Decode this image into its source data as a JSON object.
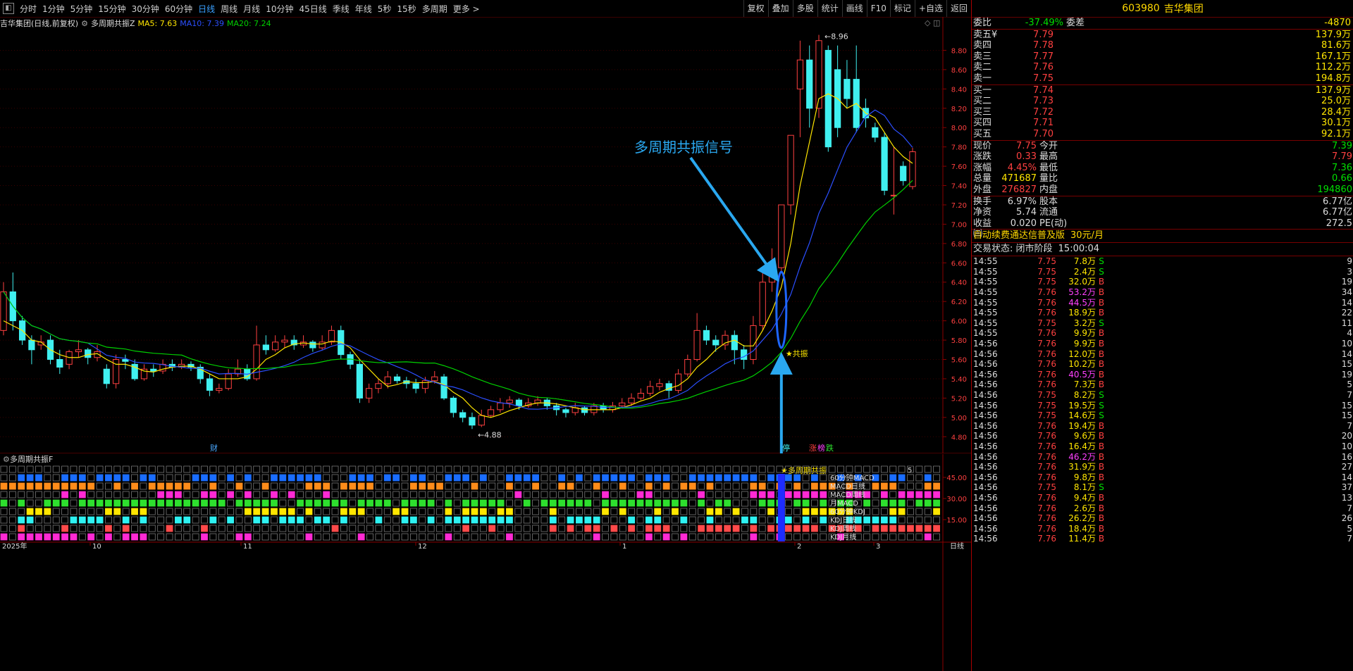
{
  "toolbar": {
    "timeframes": [
      "分时",
      "1分钟",
      "5分钟",
      "15分钟",
      "30分钟",
      "60分钟",
      "日线",
      "周线",
      "月线",
      "10分钟",
      "45日线",
      "季线",
      "年线",
      "5秒",
      "15秒",
      "多周期",
      "更多 >"
    ],
    "active_timeframe": "日线",
    "tools": [
      "复权",
      "叠加",
      "多股",
      "统计",
      "画线",
      "F10",
      "标记",
      "+自选",
      "返回"
    ]
  },
  "chart_info": {
    "title": "吉华集团(日线,前复权)",
    "indicator": "多周期共振Z",
    "ma5": "MA5: 7.63",
    "ma10": "MA10: 7.39",
    "ma20": "MA20: 7.24"
  },
  "annotation": {
    "label": "多周期共振信号",
    "signal_text": "★共振",
    "high_label": "8.96",
    "low_label": "←4.88",
    "finance_mark": "财",
    "limit_marks": [
      "停",
      "涨",
      "榜",
      "跌"
    ]
  },
  "price_axis": [
    "8.80",
    "8.60",
    "8.40",
    "8.20",
    "8.00",
    "7.80",
    "7.60",
    "7.40",
    "7.20",
    "7.00",
    "6.80",
    "6.60",
    "6.40",
    "6.20",
    "6.00",
    "5.80",
    "5.60",
    "5.40",
    "5.20",
    "5.00",
    "4.80"
  ],
  "sub_axis": [
    "45.00",
    "30.00",
    "15.00"
  ],
  "date_axis": [
    "2025年",
    "10",
    "11",
    "12",
    "1",
    "2",
    "3",
    "日线"
  ],
  "sub_panel": {
    "title": "多周期共振F",
    "signal_label": "★多周期共振",
    "row_labels": [
      "60分钟MACD",
      "MACD日线",
      "MACD周线",
      "月MACD",
      "60分钟KDJ",
      "KDJ日线",
      "KDJ周线",
      "KDJ月线"
    ],
    "row_colors": [
      "#1a6dff",
      "#ff8c1a",
      "#ff2ad4",
      "#2ee02e",
      "#ffe600",
      "#2ef2f2",
      "#ff4a4a",
      "#ff2ad4"
    ],
    "corner": "5"
  },
  "chart_data": {
    "type": "candlestick",
    "title": "吉华集团(日线,前复权)",
    "ylim": [
      4.7,
      9.0
    ],
    "high": 8.96,
    "low": 4.88,
    "candles": [
      [
        5.9,
        6.3,
        6.4,
        5.85
      ],
      [
        6.3,
        6.0,
        6.5,
        5.9
      ],
      [
        6.0,
        5.8,
        6.05,
        5.75
      ],
      [
        5.8,
        5.7,
        5.85,
        5.55
      ],
      [
        5.75,
        5.78,
        5.85,
        5.7
      ],
      [
        5.8,
        5.6,
        5.85,
        5.55
      ],
      [
        5.6,
        5.52,
        5.7,
        5.45
      ],
      [
        5.55,
        5.68,
        5.7,
        5.5
      ],
      [
        5.68,
        5.7,
        5.8,
        5.62
      ],
      [
        5.7,
        5.62,
        5.72,
        5.55
      ],
      [
        5.62,
        5.68,
        5.75,
        5.58
      ],
      [
        5.5,
        5.35,
        5.55,
        5.3
      ],
      [
        5.35,
        5.6,
        5.65,
        5.3
      ],
      [
        5.6,
        5.58,
        5.65,
        5.5
      ],
      [
        5.55,
        5.4,
        5.6,
        5.38
      ],
      [
        5.4,
        5.5,
        5.55,
        5.38
      ],
      [
        5.5,
        5.48,
        5.55,
        5.42
      ],
      [
        5.48,
        5.55,
        5.6,
        5.45
      ],
      [
        5.55,
        5.52,
        5.6,
        5.48
      ],
      [
        5.52,
        5.55,
        5.6,
        5.5
      ],
      [
        5.55,
        5.52,
        5.58,
        5.48
      ],
      [
        5.52,
        5.4,
        5.55,
        5.35
      ],
      [
        5.4,
        5.28,
        5.45,
        5.22
      ],
      [
        5.28,
        5.3,
        5.35,
        5.25
      ],
      [
        5.3,
        5.45,
        5.5,
        5.28
      ],
      [
        5.45,
        5.5,
        5.6,
        5.42
      ],
      [
        5.5,
        5.4,
        5.55,
        5.38
      ],
      [
        5.4,
        5.75,
        5.95,
        5.38
      ],
      [
        5.75,
        5.7,
        5.85,
        5.65
      ],
      [
        5.7,
        5.78,
        5.85,
        5.68
      ],
      [
        5.78,
        5.8,
        5.85,
        5.72
      ],
      [
        5.8,
        5.75,
        5.85,
        5.7
      ],
      [
        5.75,
        5.78,
        5.85,
        5.72
      ],
      [
        5.78,
        5.72,
        5.8,
        5.68
      ],
      [
        5.72,
        5.78,
        5.85,
        5.7
      ],
      [
        5.78,
        5.9,
        5.95,
        5.75
      ],
      [
        5.9,
        5.65,
        5.95,
        5.6
      ],
      [
        5.65,
        5.55,
        5.68,
        5.5
      ],
      [
        5.55,
        5.2,
        5.6,
        5.15
      ],
      [
        5.2,
        5.3,
        5.35,
        5.15
      ],
      [
        5.3,
        5.35,
        5.4,
        5.25
      ],
      [
        5.35,
        5.42,
        5.48,
        5.3
      ],
      [
        5.42,
        5.38,
        5.45,
        5.35
      ],
      [
        5.38,
        5.35,
        5.42,
        5.3
      ],
      [
        5.35,
        5.3,
        5.4,
        5.25
      ],
      [
        5.3,
        5.38,
        5.42,
        5.25
      ],
      [
        5.38,
        5.42,
        5.48,
        5.35
      ],
      [
        5.42,
        5.2,
        5.45,
        5.18
      ],
      [
        5.2,
        5.05,
        5.22,
        5.0
      ],
      [
        5.05,
        5.0,
        5.08,
        4.95
      ],
      [
        5.0,
        4.92,
        5.05,
        4.88
      ],
      [
        4.92,
        5.02,
        5.08,
        4.9
      ],
      [
        5.02,
        5.08,
        5.12,
        5.0
      ],
      [
        5.08,
        5.15,
        5.2,
        5.05
      ],
      [
        5.15,
        5.18,
        5.22,
        5.1
      ],
      [
        5.18,
        5.12,
        5.2,
        5.08
      ],
      [
        5.12,
        5.15,
        5.2,
        5.1
      ],
      [
        5.15,
        5.18,
        5.22,
        5.12
      ],
      [
        5.18,
        5.12,
        5.2,
        5.08
      ],
      [
        5.12,
        5.08,
        5.15,
        5.02
      ],
      [
        5.08,
        5.05,
        5.1,
        5.0
      ],
      [
        5.05,
        5.1,
        5.15,
        5.02
      ],
      [
        5.1,
        5.05,
        5.12,
        5.02
      ],
      [
        5.05,
        5.12,
        5.15,
        5.02
      ],
      [
        5.12,
        5.08,
        5.15,
        5.05
      ],
      [
        5.08,
        5.12,
        5.16,
        5.05
      ],
      [
        5.12,
        5.15,
        5.2,
        5.1
      ],
      [
        5.15,
        5.2,
        5.25,
        5.12
      ],
      [
        5.2,
        5.25,
        5.3,
        5.18
      ],
      [
        5.25,
        5.32,
        5.38,
        5.22
      ],
      [
        5.32,
        5.35,
        5.4,
        5.28
      ],
      [
        5.35,
        5.28,
        5.38,
        5.2
      ],
      [
        5.28,
        5.45,
        5.5,
        5.25
      ],
      [
        5.45,
        5.6,
        5.65,
        5.42
      ],
      [
        5.6,
        5.9,
        6.08,
        5.58
      ],
      [
        5.9,
        5.8,
        5.95,
        5.75
      ],
      [
        5.8,
        5.75,
        5.85,
        5.68
      ],
      [
        5.75,
        5.85,
        5.9,
        5.7
      ],
      [
        5.85,
        5.7,
        5.9,
        5.55
      ],
      [
        5.7,
        5.6,
        5.75,
        5.5
      ],
      [
        5.6,
        5.95,
        6.05,
        5.55
      ],
      [
        5.95,
        6.4,
        6.5,
        5.9
      ],
      [
        6.4,
        6.55,
        6.75,
        6.3
      ],
      [
        6.55,
        7.2,
        7.2,
        6.5
      ],
      [
        7.2,
        7.92,
        7.92,
        7.1
      ],
      [
        8.4,
        8.7,
        8.9,
        7.9
      ],
      [
        8.7,
        8.2,
        8.85,
        8.0
      ],
      [
        8.2,
        8.9,
        8.96,
        8.1
      ],
      [
        8.8,
        7.8,
        8.85,
        7.75
      ],
      [
        8.6,
        8.0,
        8.85,
        7.9
      ],
      [
        8.5,
        8.3,
        8.7,
        8.2
      ],
      [
        8.5,
        8.0,
        8.85,
        7.95
      ],
      [
        8.2,
        8.1,
        8.3,
        8.0
      ],
      [
        8.0,
        7.9,
        8.05,
        7.85
      ],
      [
        7.9,
        7.35,
        7.95,
        7.3
      ],
      [
        7.3,
        7.3,
        7.8,
        7.1
      ],
      [
        7.6,
        7.45,
        7.65,
        7.4
      ],
      [
        7.39,
        7.75,
        7.79,
        7.36
      ]
    ],
    "ma5": [
      6.0,
      5.95,
      5.9,
      5.8,
      5.78,
      5.7,
      5.65,
      5.62,
      5.62,
      5.65,
      5.66,
      5.6,
      5.55,
      5.55,
      5.52,
      5.48,
      5.47,
      5.5,
      5.52,
      5.53,
      5.53,
      5.5,
      5.45,
      5.4,
      5.4,
      5.4,
      5.42,
      5.5,
      5.6,
      5.65,
      5.72,
      5.76,
      5.77,
      5.76,
      5.76,
      5.79,
      5.78,
      5.72,
      5.6,
      5.5,
      5.4,
      5.32,
      5.34,
      5.37,
      5.36,
      5.36,
      5.37,
      5.34,
      5.26,
      5.2,
      5.1,
      5.02,
      5.0,
      5.03,
      5.07,
      5.1,
      5.13,
      5.15,
      5.15,
      5.14,
      5.12,
      5.1,
      5.08,
      5.08,
      5.08,
      5.08,
      5.1,
      5.13,
      5.17,
      5.2,
      5.26,
      5.3,
      5.33,
      5.4,
      5.52,
      5.6,
      5.7,
      5.77,
      5.8,
      5.74,
      5.74,
      5.9,
      6.1,
      6.35,
      6.8,
      7.4,
      7.85,
      8.3,
      8.35,
      8.3,
      8.2,
      8.25,
      8.15,
      8.1,
      7.95,
      7.8,
      7.7,
      7.63
    ]
  },
  "right_panel": {
    "code": "603980",
    "name": "吉华集团",
    "weibi_label": "委比",
    "weibi": "-37.49%",
    "weicha_label": "委差",
    "weicha": "-4870",
    "asks": [
      {
        "label": "卖五",
        "mark": "¥",
        "price": "7.79",
        "vol": "137.9万"
      },
      {
        "label": "卖四",
        "mark": "",
        "price": "7.78",
        "vol": "81.6万"
      },
      {
        "label": "卖三",
        "mark": "",
        "price": "7.77",
        "vol": "167.1万"
      },
      {
        "label": "卖二",
        "mark": "",
        "price": "7.76",
        "vol": "112.2万"
      },
      {
        "label": "卖一",
        "mark": "",
        "price": "7.75",
        "vol": "194.8万"
      }
    ],
    "bids": [
      {
        "label": "买一",
        "price": "7.74",
        "vol": "137.9万"
      },
      {
        "label": "买二",
        "price": "7.73",
        "vol": "25.0万"
      },
      {
        "label": "买三",
        "price": "7.72",
        "vol": "28.4万"
      },
      {
        "label": "买四",
        "price": "7.71",
        "vol": "30.1万"
      },
      {
        "label": "买五",
        "price": "7.70",
        "vol": "92.1万"
      }
    ],
    "quote": [
      [
        [
          "现价",
          "7.75",
          "red"
        ],
        [
          "今开",
          "7.39",
          "green"
        ]
      ],
      [
        [
          "涨跌",
          "0.33",
          "red"
        ],
        [
          "最高",
          "7.79",
          "red"
        ]
      ],
      [
        [
          "涨幅",
          "4.45%",
          "red"
        ],
        [
          "最低",
          "7.36",
          "green"
        ]
      ],
      [
        [
          "总量",
          "471687",
          "yellow"
        ],
        [
          "量比",
          "0.66",
          "green"
        ]
      ],
      [
        [
          "外盘",
          "276827",
          "red"
        ],
        [
          "内盘",
          "194860",
          "green"
        ]
      ]
    ],
    "stats": [
      [
        [
          "换手",
          "6.97%",
          "white"
        ],
        [
          "股本",
          "6.77亿",
          "white"
        ]
      ],
      [
        [
          "净资",
          "5.74",
          "white"
        ],
        [
          "流通",
          "6.77亿",
          "white"
        ]
      ],
      [
        [
          "收益㈢",
          "0.020",
          "white"
        ],
        [
          "PE(动)",
          "272.5",
          "white"
        ]
      ]
    ],
    "ad": {
      "text": "自动续费通达信普及版",
      "price": "30元/月"
    },
    "state": {
      "label": "交易状态: 闭市阶段",
      "time": "15:00:04"
    },
    "ticks": [
      [
        "14:55",
        "7.75",
        "7.8万",
        "S",
        "9"
      ],
      [
        "14:55",
        "7.75",
        "2.4万",
        "S",
        "3"
      ],
      [
        "14:55",
        "7.75",
        "32.0万",
        "B",
        "19"
      ],
      [
        "14:55",
        "7.76",
        "53.2万",
        "B",
        "34"
      ],
      [
        "14:55",
        "7.76",
        "44.5万",
        "B",
        "14"
      ],
      [
        "14:55",
        "7.76",
        "18.9万",
        "B",
        "22"
      ],
      [
        "14:55",
        "7.75",
        "3.2万",
        "S",
        "11"
      ],
      [
        "14:55",
        "7.76",
        "9.9万",
        "B",
        "4"
      ],
      [
        "14:56",
        "7.76",
        "9.9万",
        "B",
        "10"
      ],
      [
        "14:56",
        "7.76",
        "12.0万",
        "B",
        "14"
      ],
      [
        "14:56",
        "7.76",
        "10.2万",
        "B",
        "15"
      ],
      [
        "14:56",
        "7.76",
        "40.5万",
        "B",
        "19"
      ],
      [
        "14:56",
        "7.76",
        "7.3万",
        "B",
        "5"
      ],
      [
        "14:56",
        "7.75",
        "8.2万",
        "S",
        "7"
      ],
      [
        "14:56",
        "7.75",
        "19.5万",
        "S",
        "15"
      ],
      [
        "14:56",
        "7.75",
        "14.6万",
        "S",
        "15"
      ],
      [
        "14:56",
        "7.76",
        "19.4万",
        "B",
        "7"
      ],
      [
        "14:56",
        "7.76",
        "9.6万",
        "B",
        "20"
      ],
      [
        "14:56",
        "7.76",
        "16.4万",
        "B",
        "10"
      ],
      [
        "14:56",
        "7.76",
        "46.2万",
        "B",
        "16"
      ],
      [
        "14:56",
        "7.76",
        "31.9万",
        "B",
        "27"
      ],
      [
        "14:56",
        "7.76",
        "9.8万",
        "B",
        "14"
      ],
      [
        "14:56",
        "7.75",
        "8.1万",
        "S",
        "37"
      ],
      [
        "14:56",
        "7.76",
        "9.4万",
        "B",
        "13"
      ],
      [
        "14:56",
        "7.76",
        "2.6万",
        "B",
        "7"
      ],
      [
        "14:56",
        "7.76",
        "26.2万",
        "B",
        "26"
      ],
      [
        "14:56",
        "7.76",
        "18.4万",
        "B",
        "5"
      ],
      [
        "14:56",
        "7.76",
        "11.4万",
        "B",
        "7"
      ]
    ]
  }
}
